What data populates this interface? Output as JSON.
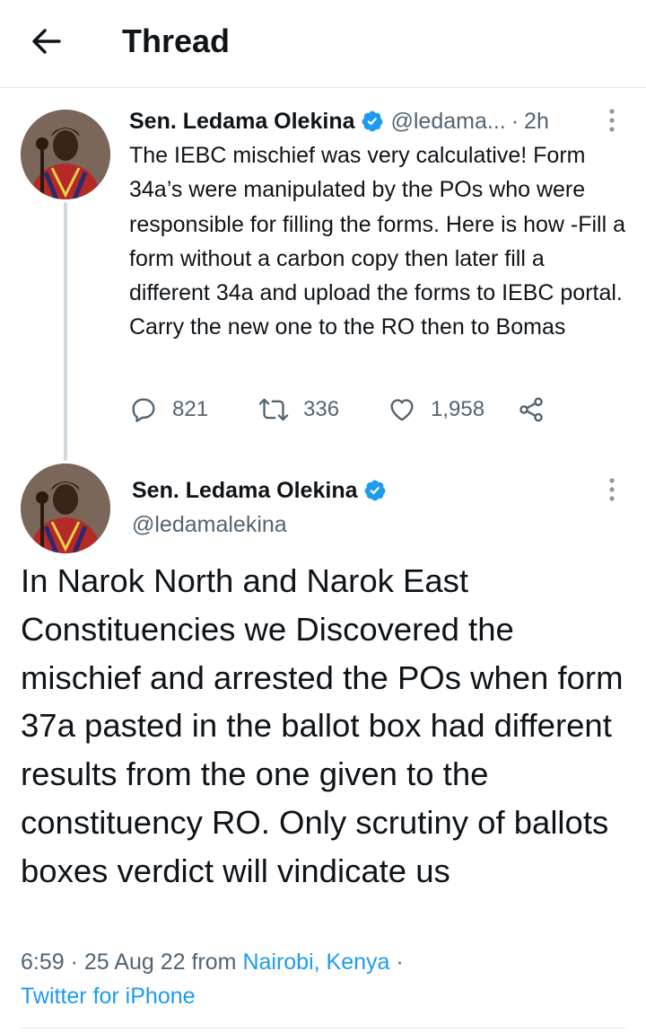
{
  "header": {
    "title": "Thread",
    "back_icon": "arrow-left-icon"
  },
  "colors": {
    "accent": "#1d9bf0",
    "text": "#0f1419",
    "muted": "#536471",
    "divider": "#e3e6e8"
  },
  "tweet1": {
    "author_name": "Sen. Ledama Olekina",
    "handle": "@ledama...",
    "separator": "·",
    "time": "2h",
    "text": "The IEBC mischief was very calculative! Form 34a’s were manipulated by the POs who were responsible for filling the forms. Here is how -Fill a form without a carbon copy then later fill a different 34a and upload the forms to IEBC portal. Carry the new one to the RO then to Bomas",
    "replies": "821",
    "retweets": "336",
    "likes": "1,958",
    "icons": [
      "reply-icon",
      "retweet-icon",
      "like-icon",
      "share-icon",
      "more-icon",
      "verified-icon"
    ]
  },
  "tweet2": {
    "author_name": "Sen. Ledama Olekina",
    "handle": "@ledamalekina",
    "text": "In Narok North and Narok East Constituencies we Discovered the mischief and arrested the POs when form 37a pasted in the ballot box had different results from the one given to the constituency RO. Only scrutiny of ballots boxes verdict will vindicate us",
    "time": "6:59",
    "date": "25 Aug 22",
    "from_label": "from",
    "location": "Nairobi, Kenya",
    "client": "Twitter for iPhone",
    "separator": "·"
  }
}
